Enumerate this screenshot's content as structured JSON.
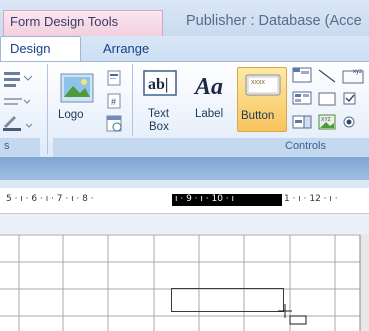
{
  "title_bar": {
    "contextual_tab": "Form Design Tools",
    "app_title": "Publisher : Database (Acce"
  },
  "tabs": [
    {
      "label": "Design",
      "active": true
    },
    {
      "label": "Arrange",
      "active": false
    }
  ],
  "ribbon": {
    "buttons": {
      "logo": "Logo",
      "text_box": [
        "Text",
        "Box"
      ],
      "label": "Label",
      "button": "Button",
      "button_preview": "xxxx"
    },
    "groups": {
      "left_partial": "s",
      "controls": "Controls"
    }
  },
  "ruler": {
    "ticks_left": "5 · ı · 6 · ı · 7 · ı · 8 ·",
    "ticks_selected": "ı · 9 · ı · 10 · ı",
    "ticks_right": "1 · ı · 12 · ı ·"
  },
  "colors": {
    "ribbon_text": "#1e395b",
    "tab_text": "#15428b",
    "contextual_tab_bg": "#f2cfde",
    "button_highlight": "#f8c45c"
  }
}
